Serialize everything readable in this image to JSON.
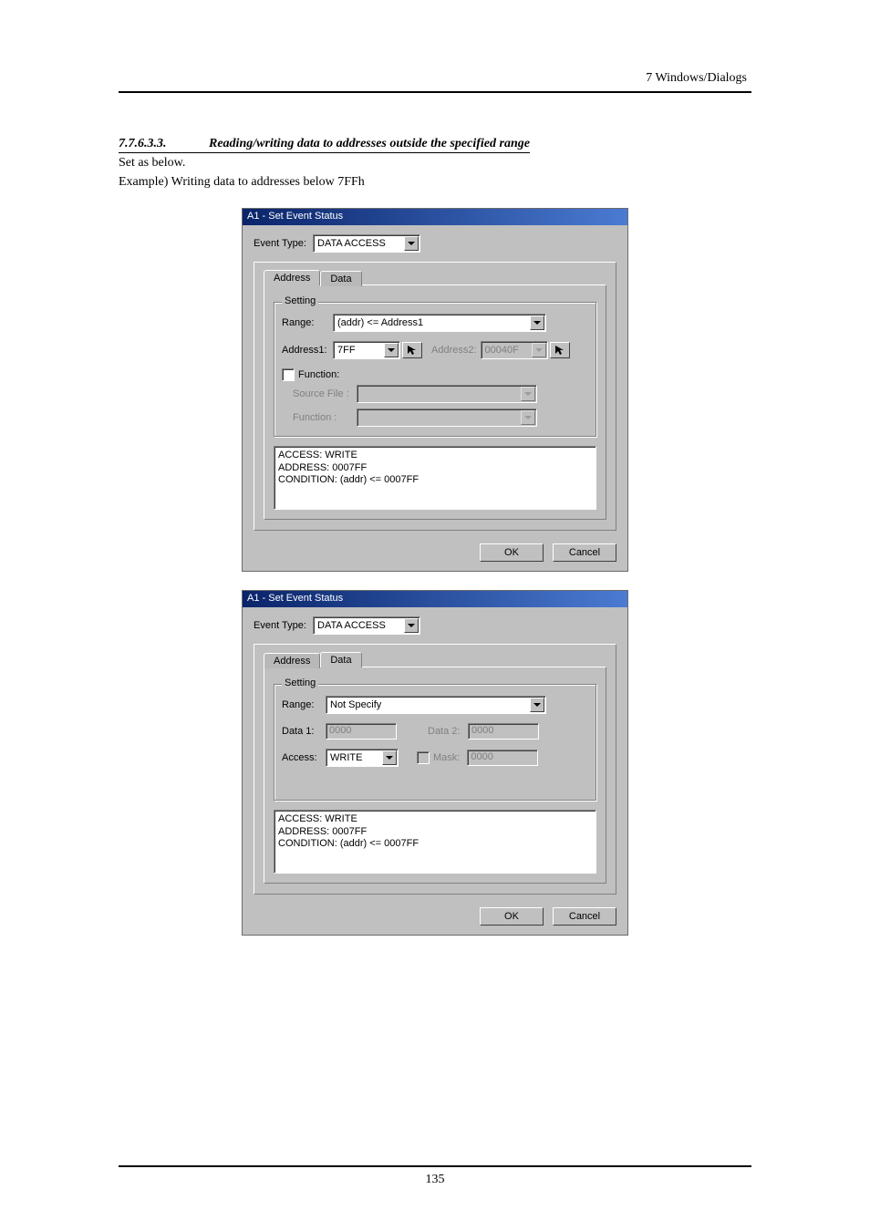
{
  "page": {
    "running_head": "7  Windows/Dialogs",
    "section_number": "7.7.6.3.3.",
    "section_title": "Reading/writing data to addresses outside the specified range",
    "line1": "Set as below.",
    "line2": "Example) Writing data to addresses below 7FFh",
    "page_number": "135"
  },
  "dlg1": {
    "title": "A1 - Set Event Status",
    "event_type_label": "Event Type:",
    "event_type_value": "DATA ACCESS",
    "tabs": {
      "address": "Address",
      "data": "Data"
    },
    "group": "Setting",
    "range_label": "Range:",
    "range_value": "(addr) <= Address1",
    "addr1_label": "Address1:",
    "addr1_value": "7FF",
    "addr2_label": "Address2:",
    "addr2_value": "00040F",
    "function_ck": "Function:",
    "src_label": "Source File :",
    "func_label": "Function :",
    "status": "ACCESS: WRITE\nADDRESS: 0007FF\nCONDITION: (addr) <= 0007FF",
    "ok": "OK",
    "cancel": "Cancel"
  },
  "dlg2": {
    "title": "A1 - Set Event Status",
    "event_type_label": "Event Type:",
    "event_type_value": "DATA ACCESS",
    "tabs": {
      "address": "Address",
      "data": "Data"
    },
    "group": "Setting",
    "range_label": "Range:",
    "range_value": "Not Specify",
    "data1_label": "Data 1:",
    "data1_value": "0000",
    "data2_label": "Data 2:",
    "data2_value": "0000",
    "access_label": "Access:",
    "access_value": "WRITE",
    "mask_label": "Mask:",
    "mask_value": "0000",
    "status": "ACCESS: WRITE\nADDRESS: 0007FF\nCONDITION: (addr) <= 0007FF",
    "ok": "OK",
    "cancel": "Cancel"
  }
}
